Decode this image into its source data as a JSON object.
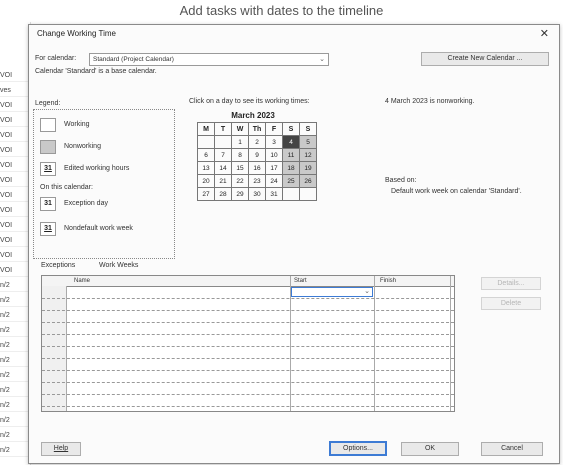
{
  "app": {
    "title": "Add tasks with dates to the timeline"
  },
  "background_rows": [
    "VOI",
    "ves",
    "VOI",
    "VOI",
    "VOI",
    "VOI",
    "VOI",
    "VOI",
    "VOI",
    "VOI",
    "VOI",
    "VOI",
    "VOI",
    "VOI",
    "n/2",
    "n/2",
    "n/2",
    "n/2",
    "n/2",
    "n/2",
    "n/2",
    "n/2",
    "n/2",
    "n/2",
    "n/2",
    "n/2"
  ],
  "dialog": {
    "title": "Change Working Time",
    "for_calendar_label": "For calendar:",
    "calendar_select": "Standard (Project Calendar)",
    "create_new_button": "Create New Calendar ...",
    "base_calendar_note": "Calendar 'Standard' is a base calendar.",
    "legend_label": "Legend:",
    "legend_items": [
      {
        "label": "Working",
        "swatch": ""
      },
      {
        "label": "Nonworking",
        "swatch": ""
      },
      {
        "label": "Edited working hours",
        "swatch": "31"
      }
    ],
    "on_this_calendar": "On this calendar:",
    "legend_items2": [
      {
        "label": "Exception day",
        "swatch": "31"
      },
      {
        "label": "Nondefault work week",
        "swatch": "31"
      }
    ],
    "click_hint": "Click on a day to see its working times:",
    "day_info": "4 March 2023 is nonworking.",
    "based_on": "Based on:",
    "based_on_detail": "Default work week on calendar 'Standard'.",
    "calendar": {
      "month": "March 2023",
      "weekdays": [
        "M",
        "T",
        "W",
        "Th",
        "F",
        "S",
        "S"
      ],
      "weeks": [
        [
          "",
          "",
          "1",
          "2",
          "3",
          "4",
          "5"
        ],
        [
          "6",
          "7",
          "8",
          "9",
          "10",
          "11",
          "12"
        ],
        [
          "13",
          "14",
          "15",
          "16",
          "17",
          "18",
          "19"
        ],
        [
          "20",
          "21",
          "22",
          "23",
          "24",
          "25",
          "26"
        ],
        [
          "27",
          "28",
          "29",
          "30",
          "31",
          "",
          ""
        ]
      ]
    },
    "tabs": [
      "Exceptions",
      "Work Weeks"
    ],
    "table_headers": [
      "Name",
      "Start",
      "Finish"
    ],
    "details_button": "Details...",
    "delete_button": "Delete",
    "help_button": "Help",
    "options_button": "Options...",
    "ok_button": "OK",
    "cancel_button": "Cancel",
    "close_glyph": "✕"
  }
}
